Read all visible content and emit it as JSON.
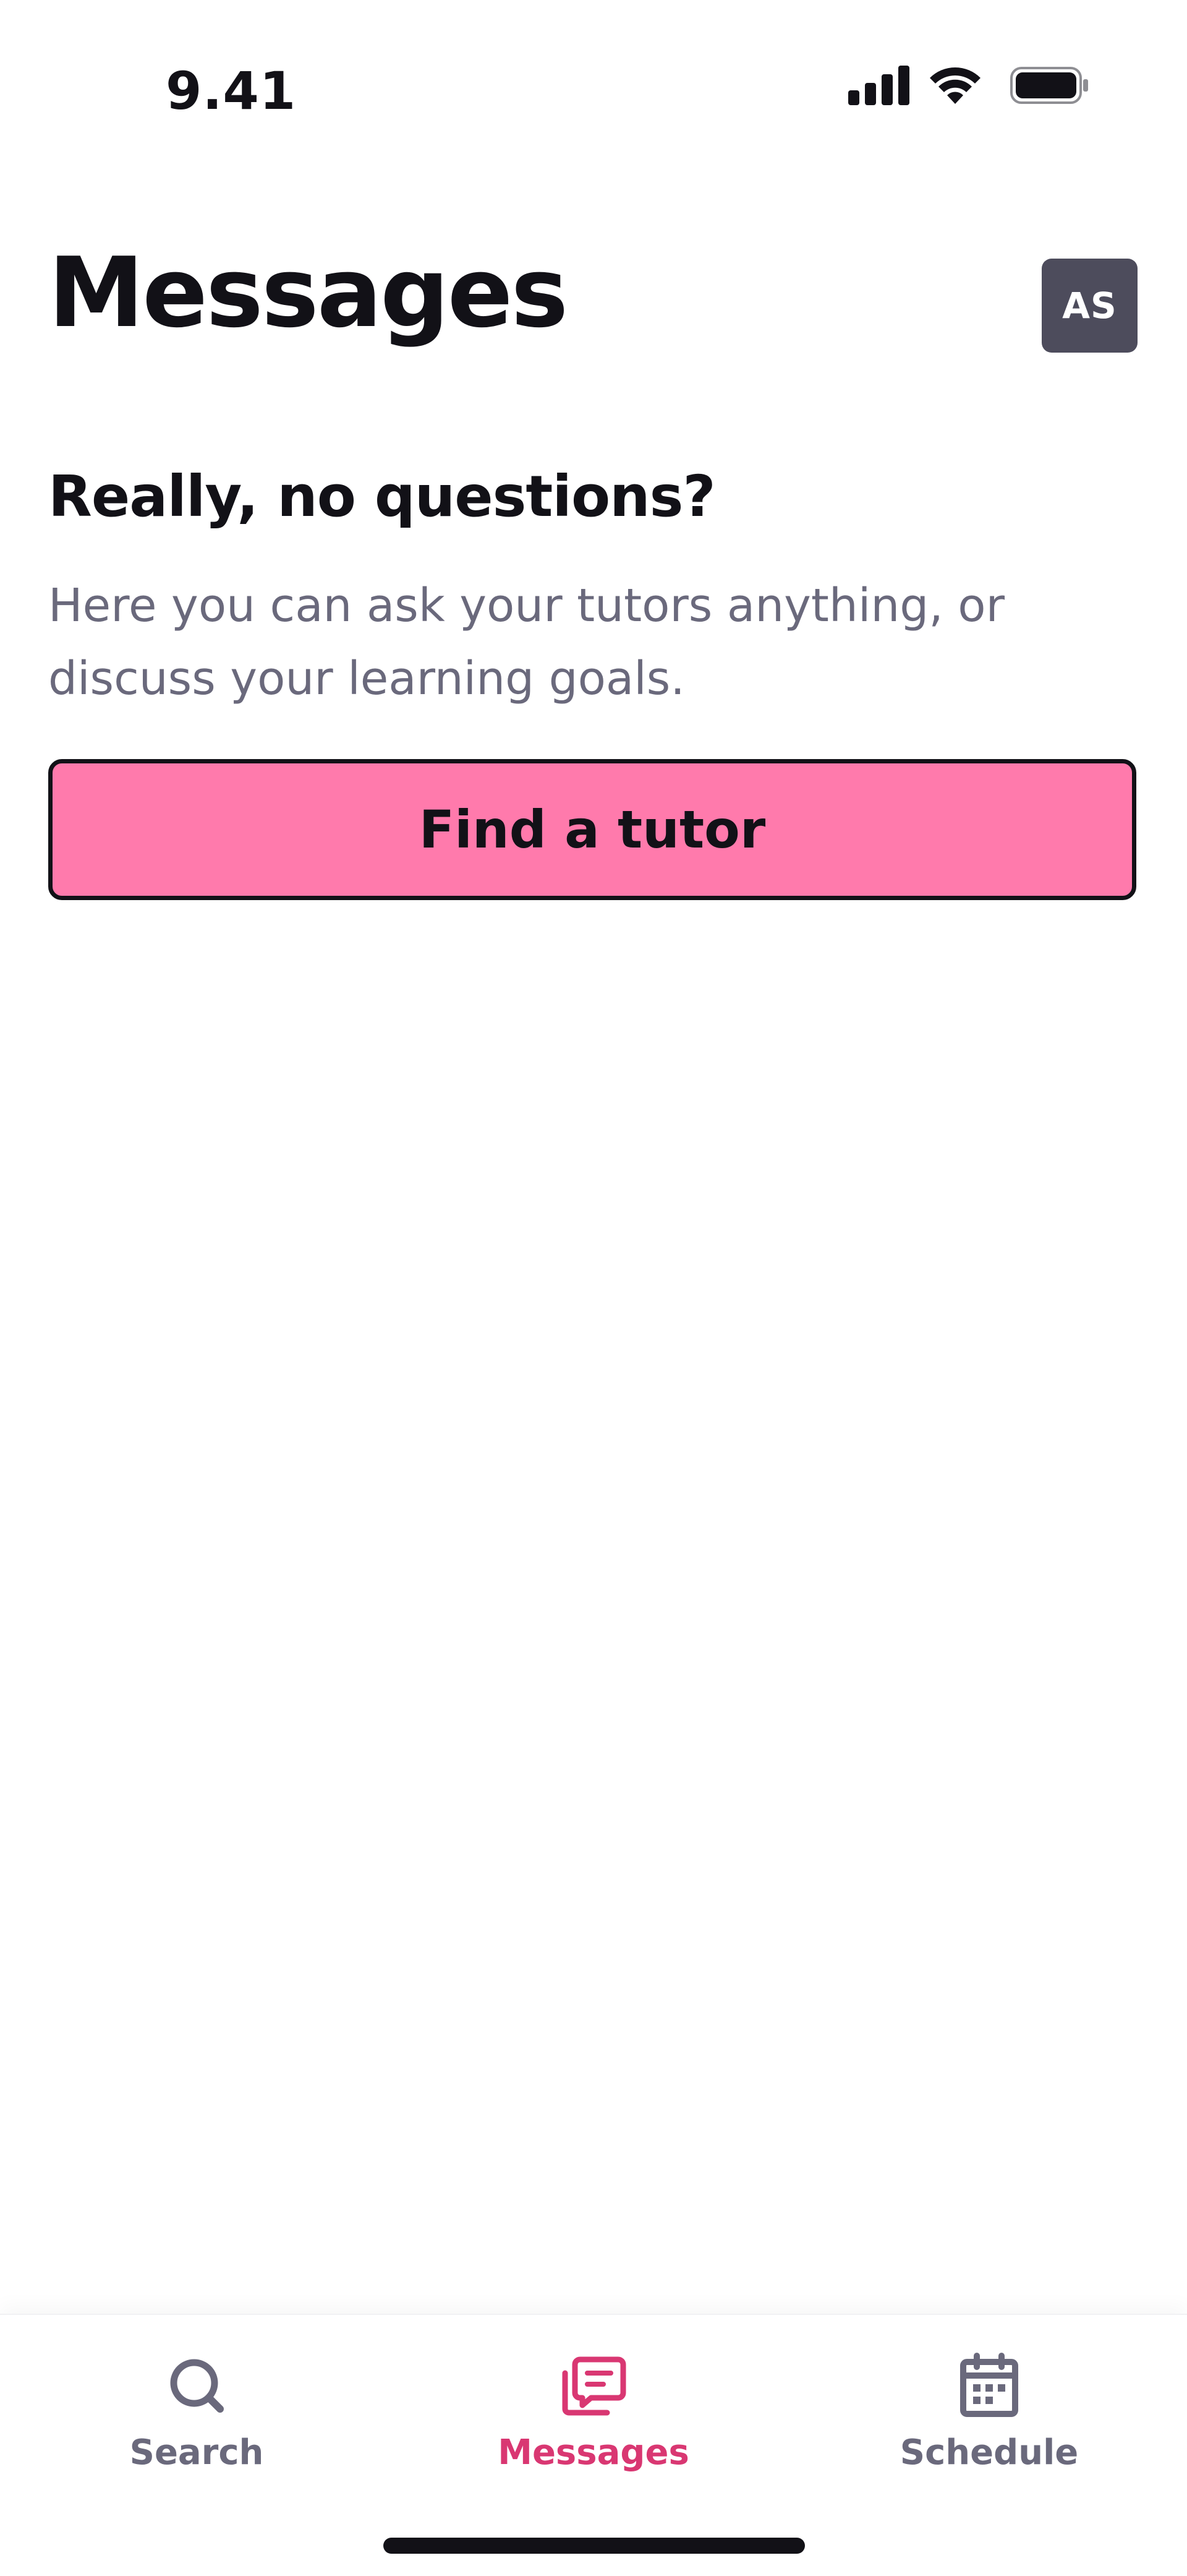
{
  "status_bar": {
    "time": "9.41",
    "icons": [
      "signal-icon",
      "wifi-icon",
      "battery-icon"
    ]
  },
  "header": {
    "title": "Messages",
    "avatar_initials": "AS"
  },
  "empty_state": {
    "heading": "Really, no questions?",
    "description": "Here you can ask your tutors anything, or discuss your learning goals.",
    "button_label": "Find a tutor"
  },
  "tab_bar": {
    "tabs": [
      {
        "label": "Search",
        "icon": "search-icon",
        "active": false
      },
      {
        "label": "Messages",
        "icon": "messages-icon",
        "active": true
      },
      {
        "label": "Schedule",
        "icon": "calendar-icon",
        "active": false
      }
    ]
  },
  "colors": {
    "accent": "#ff7aac",
    "active_tab": "#d93772",
    "text_primary": "#121117",
    "text_secondary": "#6a697c",
    "avatar_bg": "#4d4c5c"
  }
}
